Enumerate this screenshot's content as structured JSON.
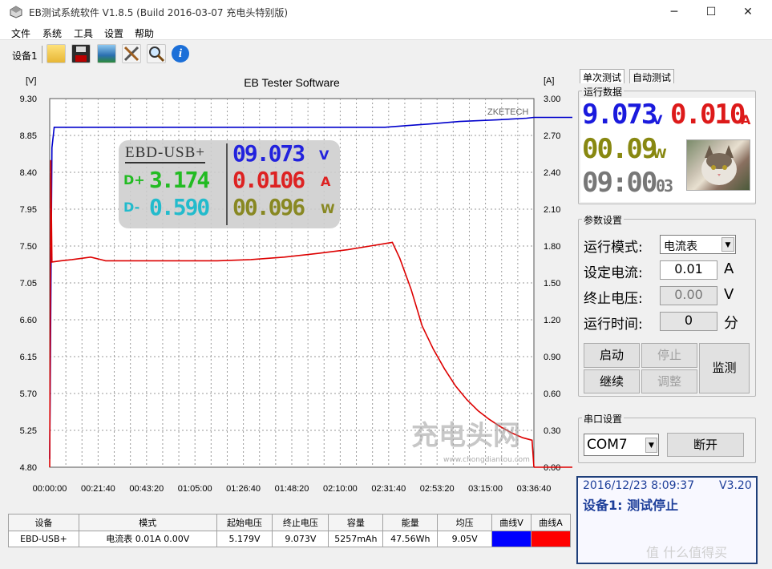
{
  "window": {
    "title": "EB测试系统软件 V1.8.5 (Build 2016-03-07 充电头特别版)",
    "minimize": "─",
    "maximize": "☐",
    "close": "✕"
  },
  "menu": {
    "items": [
      "文件",
      "系统",
      "工具",
      "设置",
      "帮助"
    ]
  },
  "toolbar": {
    "device_label": "设备1"
  },
  "chart_data": {
    "type": "line",
    "title": "EB Tester Software",
    "watermark": "ZKETECH",
    "y_left_unit": "[V]",
    "y_right_unit": "[A]",
    "y_left_ticks": [
      "9.30",
      "8.85",
      "8.40",
      "7.95",
      "7.50",
      "7.05",
      "6.60",
      "6.15",
      "5.70",
      "5.25",
      "4.80"
    ],
    "y_right_ticks": [
      "3.00",
      "2.70",
      "2.40",
      "2.10",
      "1.80",
      "1.50",
      "1.20",
      "0.90",
      "0.60",
      "0.30",
      "0.00"
    ],
    "x_ticks": [
      "00:00:00",
      "00:21:40",
      "00:43:20",
      "01:05:00",
      "01:26:40",
      "01:48:20",
      "02:10:00",
      "02:31:40",
      "02:53:20",
      "03:15:00",
      "03:36:40"
    ],
    "ylim_left": [
      4.8,
      9.3
    ],
    "ylim_right": [
      0.0,
      3.0
    ],
    "xlim_seconds": [
      0,
      13000
    ],
    "series": [
      {
        "name": "曲线V",
        "color": "#0000cc",
        "axis": "left",
        "points": [
          [
            0,
            4.9
          ],
          [
            60,
            8.7
          ],
          [
            120,
            8.95
          ],
          [
            1000,
            8.95
          ],
          [
            3000,
            8.95
          ],
          [
            5000,
            8.95
          ],
          [
            7000,
            8.95
          ],
          [
            9000,
            8.95
          ],
          [
            9600,
            8.97
          ],
          [
            10200,
            8.99
          ],
          [
            11000,
            9.02
          ],
          [
            12000,
            9.04
          ],
          [
            12800,
            9.06
          ],
          [
            13000,
            9.07
          ]
        ]
      },
      {
        "name": "曲线A",
        "color": "#dd0000",
        "axis": "right",
        "points": [
          [
            0,
            0.0
          ],
          [
            30,
            2.5
          ],
          [
            60,
            1.67
          ],
          [
            300,
            1.68
          ],
          [
            600,
            1.69
          ],
          [
            1100,
            1.71
          ],
          [
            1500,
            1.68
          ],
          [
            2500,
            1.68
          ],
          [
            3500,
            1.68
          ],
          [
            4500,
            1.68
          ],
          [
            5400,
            1.69
          ],
          [
            6300,
            1.71
          ],
          [
            7200,
            1.74
          ],
          [
            8000,
            1.77
          ],
          [
            8600,
            1.8
          ],
          [
            9000,
            1.82
          ],
          [
            9200,
            1.83
          ],
          [
            9400,
            1.7
          ],
          [
            9700,
            1.45
          ],
          [
            10000,
            1.15
          ],
          [
            10300,
            0.96
          ],
          [
            10600,
            0.8
          ],
          [
            10900,
            0.66
          ],
          [
            11200,
            0.55
          ],
          [
            11500,
            0.46
          ],
          [
            11800,
            0.39
          ],
          [
            12100,
            0.33
          ],
          [
            12400,
            0.28
          ],
          [
            12700,
            0.24
          ],
          [
            12950,
            0.22
          ],
          [
            13000,
            0.0
          ]
        ]
      }
    ],
    "overlay": {
      "label": "EBD-USB+",
      "voltage": "09.073",
      "voltage_unit": "V",
      "dplus_label": "D+",
      "dplus": "3.174",
      "current": "0.0106",
      "current_unit": "A",
      "dminus_label": "D-",
      "dminus": "0.590",
      "power": "00.096",
      "power_unit": "W"
    }
  },
  "table": {
    "headers": [
      "设备",
      "模式",
      "起始电压",
      "终止电压",
      "容量",
      "能量",
      "均压",
      "曲线V",
      "曲线A"
    ],
    "row": [
      "EBD-USB+",
      "电流表  0.01A  0.00V",
      "5.179V",
      "9.073V",
      "5257mAh",
      "47.56Wh",
      "9.05V"
    ],
    "curve_v_color": "#0000ff",
    "curve_a_color": "#ff0000"
  },
  "right_panel": {
    "tabs": [
      "单次测试",
      "自动测试"
    ],
    "run_data": {
      "label": "运行数据",
      "voltage": "9.073",
      "voltage_unit": "V",
      "current": "0.010",
      "current_unit": "A",
      "power": "00.09",
      "power_unit": "W",
      "time": "09:00",
      "time_small": "03"
    },
    "params": {
      "label": "参数设置",
      "mode_label": "运行模式:",
      "mode_value": "电流表",
      "set_current_label": "设定电流:",
      "set_current_value": "0.01",
      "set_current_unit": "A",
      "stop_voltage_label": "终止电压:",
      "stop_voltage_value": "0.00",
      "stop_voltage_unit": "V",
      "run_time_label": "运行时间:",
      "run_time_value": "0",
      "run_time_unit": "分",
      "buttons": {
        "start": "启动",
        "stop": "停止",
        "continue": "继续",
        "adjust": "调整",
        "monitor": "监测"
      }
    },
    "serial": {
      "label": "串口设置",
      "port": "COM7",
      "disconnect": "断开"
    },
    "status": {
      "datetime": "2016/12/23 8:09:37",
      "version": "V3.20",
      "message": "设备1: 测试停止"
    }
  },
  "watermarks": {
    "chart_logo": "充电头网",
    "chart_logo_url": "www.chongdiantou.com",
    "corner": "值 什么值得买"
  }
}
